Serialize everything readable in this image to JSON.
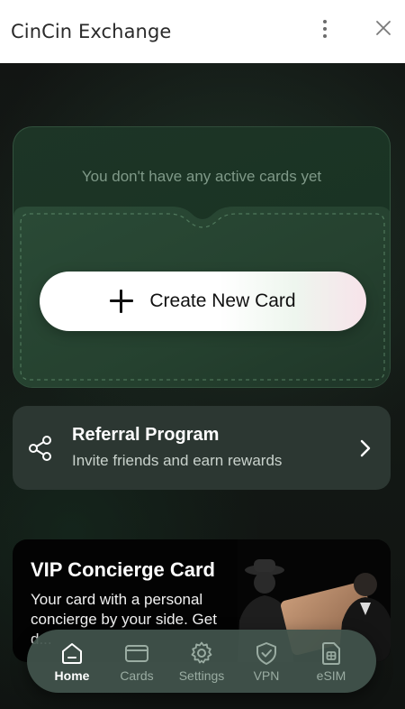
{
  "window": {
    "title": "CinCin Exchange",
    "menu_icon": "more-vertical-icon",
    "close_icon": "close-icon"
  },
  "cards": {
    "empty_message": "You don't have any active cards yet",
    "create_button_label": "Create New Card"
  },
  "referral": {
    "title": "Referral Program",
    "subtitle": "Invite friends and earn rewards",
    "icon": "share-icon"
  },
  "vip": {
    "title": "VIP Concierge Card",
    "description": "Your card with a personal concierge by your side. Get d..."
  },
  "nav": {
    "active": "Home",
    "items": [
      {
        "label": "Home",
        "icon": "home-icon"
      },
      {
        "label": "Cards",
        "icon": "card-icon"
      },
      {
        "label": "Settings",
        "icon": "gear-icon"
      },
      {
        "label": "VPN",
        "icon": "shield-check-icon"
      },
      {
        "label": "eSIM",
        "icon": "sim-card-icon"
      }
    ]
  },
  "colors": {
    "accent_green": "#1d3526",
    "nav_background": "#42544c",
    "referral_background": "#2c3732",
    "vip_background": "#030303"
  }
}
